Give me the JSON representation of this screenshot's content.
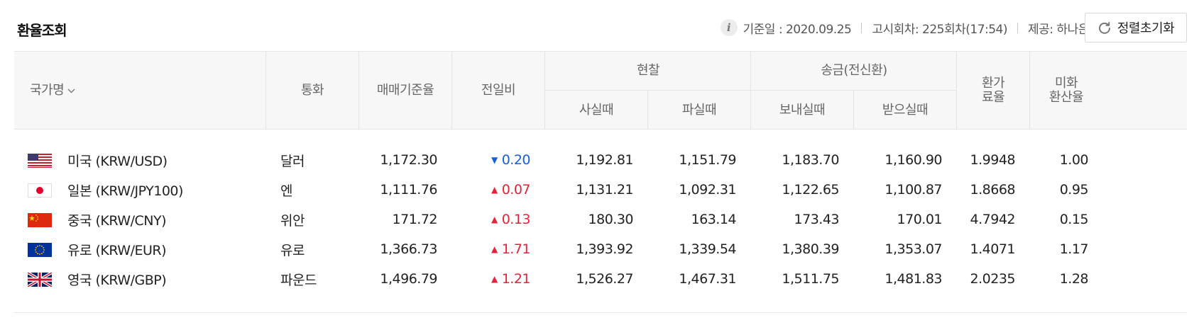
{
  "header": {
    "title": "환율조회",
    "base_date": "기준일 : 2020.09.25",
    "notice": "고시회차: 225회차(17:54)",
    "provider": "제공: 하나은행",
    "reset_label": "정렬초기화"
  },
  "columns": {
    "country": "국가명",
    "currency": "통화",
    "base_rate": "매매기준율",
    "change": "전일비",
    "cash": "현찰",
    "cash_buy": "사실때",
    "cash_sell": "파실때",
    "remit": "송금(전신환)",
    "remit_send": "보내실때",
    "remit_receive": "받으실때",
    "fx_rate_l1": "환가",
    "fx_rate_l2": "료율",
    "usd_rate_l1": "미화",
    "usd_rate_l2": "환산율"
  },
  "rows": [
    {
      "flag": "us-flag",
      "country": "미국 (KRW/USD)",
      "currency": "달러",
      "base": "1,172.30",
      "dir": "down",
      "change": "0.20",
      "cash_buy": "1,192.81",
      "cash_sell": "1,151.79",
      "send": "1,183.70",
      "receive": "1,160.90",
      "fx": "1.9948",
      "usd": "1.00"
    },
    {
      "flag": "jp-flag",
      "country": "일본 (KRW/JPY100)",
      "currency": "엔",
      "base": "1,111.76",
      "dir": "up",
      "change": "0.07",
      "cash_buy": "1,131.21",
      "cash_sell": "1,092.31",
      "send": "1,122.65",
      "receive": "1,100.87",
      "fx": "1.8668",
      "usd": "0.95"
    },
    {
      "flag": "cn-flag",
      "country": "중국 (KRW/CNY)",
      "currency": "위안",
      "base": "171.72",
      "dir": "up",
      "change": "0.13",
      "cash_buy": "180.30",
      "cash_sell": "163.14",
      "send": "173.43",
      "receive": "170.01",
      "fx": "4.7942",
      "usd": "0.15"
    },
    {
      "flag": "eu-flag",
      "country": "유로 (KRW/EUR)",
      "currency": "유로",
      "base": "1,366.73",
      "dir": "up",
      "change": "1.71",
      "cash_buy": "1,393.92",
      "cash_sell": "1,339.54",
      "send": "1,380.39",
      "receive": "1,353.07",
      "fx": "1.4071",
      "usd": "1.17"
    },
    {
      "flag": "uk-flag",
      "country": "영국 (KRW/GBP)",
      "currency": "파운드",
      "base": "1,496.79",
      "dir": "up",
      "change": "1.21",
      "cash_buy": "1,526.27",
      "cash_sell": "1,467.31",
      "send": "1,511.75",
      "receive": "1,481.83",
      "fx": "2.0235",
      "usd": "1.28"
    }
  ],
  "colors": {
    "up": "#e8213a",
    "down": "#1a5ed6"
  }
}
